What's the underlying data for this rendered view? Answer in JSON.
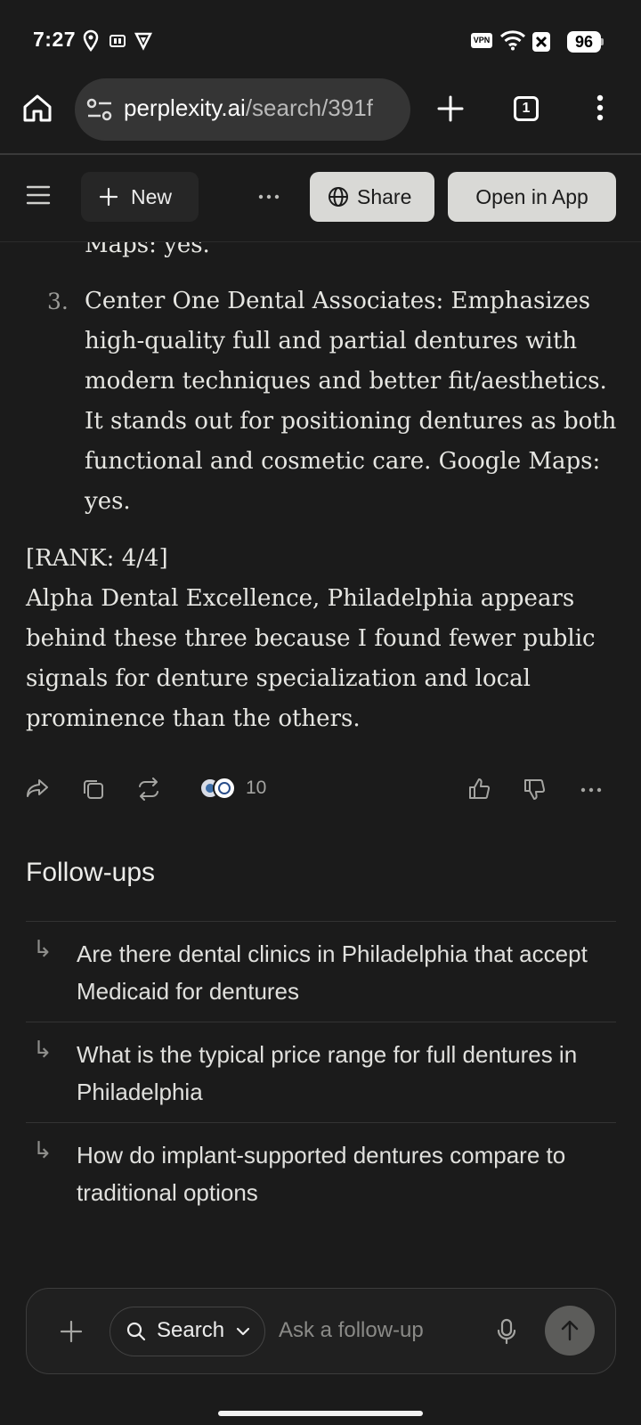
{
  "status_bar": {
    "time": "7:27",
    "vpn_label": "VPN",
    "battery_level": "96",
    "icons": [
      "location-pin-icon",
      "nfc-icon",
      "shield-icon",
      "vpn-icon",
      "wifi-icon",
      "no-signal-icon",
      "battery-icon"
    ]
  },
  "browser": {
    "url_domain": "perplexity.ai",
    "url_path": "/search/391f",
    "tab_count": "1"
  },
  "header": {
    "new_label": "New",
    "share_label": "Share",
    "open_app_label": "Open in App"
  },
  "answer": {
    "top_fragment": "Maps: yes.",
    "list_number": "3.",
    "item3_text": "Center One Dental Associates: Emphasizes high-quality full and partial dentures with modern techniques and better fit/aesthetics. It stands out for positioning dentures as both functional and cosmetic care. Google Maps: yes.",
    "rank_line": "[RANK: 4/4]",
    "rank_paragraph": "Alpha Dental Excellence, Philadelphia appears behind these three because I found fewer public signals for denture specialization and local prominence than the others."
  },
  "actions": {
    "sources_count": "10"
  },
  "followups": {
    "title": "Follow-ups",
    "items": [
      "Are there dental clinics in Philadelphia that accept Medicaid for dentures",
      "What is the typical price range for full dentures in Philadelphia",
      "How do implant-supported dentures compare to traditional options"
    ]
  },
  "input": {
    "mode_label": "Search",
    "placeholder": "Ask a follow-up"
  },
  "colors": {
    "background": "#1b1b1b",
    "pill_button": "#d9d9d6",
    "url_bar": "#353535",
    "submit_button": "#5c5c5a"
  }
}
